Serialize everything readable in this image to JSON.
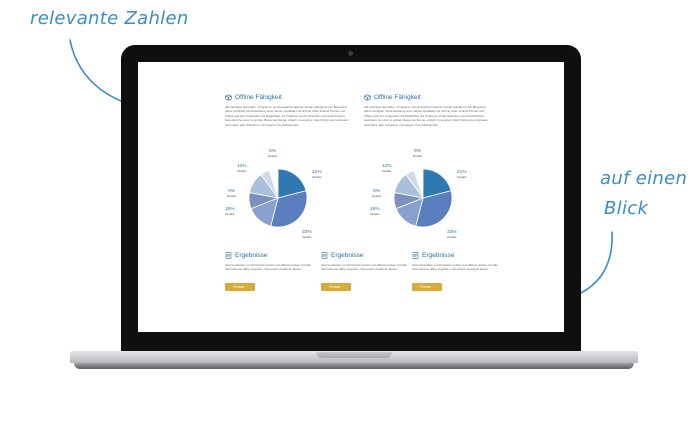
{
  "annotations": {
    "top_left": "relevante Zahlen",
    "right_line1": "auf einen",
    "right_line2": "Blick"
  },
  "sections": [
    {
      "title": "Offline Fähigkeit",
      "body": "Alle wichtigen Ausstellter-, Programm- und Zusatzinformationen wurden ständig für den Besuchern offline verfügbar. Die Entwicklung einer nativen Applikation für iPhone, iPad, Android Phones und Tablets galt dem Organisator die Möglichkeit, die Probleme mit der fehlenden Internetverbindung, besonders bei einer so großen Messe wie Ikonga, einfach zu umgehen. Das Prinzip einer optimalen Information aller Teilnehmer und steigern Ihre Zufriedenheit.",
      "pie": [
        {
          "value": "21%",
          "detail": "Details",
          "pct": 21
        },
        {
          "value": "33%",
          "detail": "Details",
          "pct": 33
        },
        {
          "value": "15%",
          "detail": "Details",
          "pct": 15
        },
        {
          "value": "9%",
          "detail": "Details",
          "pct": 9
        },
        {
          "value": "12%",
          "detail": "Details",
          "pct": 12
        },
        {
          "value": "5%",
          "detail": "Details",
          "pct": 5
        }
      ]
    },
    {
      "title": "Offline Fähigkeit",
      "body": "Alle wichtigen Ausstellter-, Programm- und Zusatzinformationen wurden ständig für den Besuchern offline verfügbar. Die Entwicklung einer nativen Applikation für iPhone, iPad, Android Phones und Tablets galt dem Organisator die Möglichkeit, die Probleme mit der fehlenden Internetverbindung, besonders bei einer so großen Messe wie Ikonga, einfach zu umgehen. Das Prinzip einer optimalen Information aller Teilnehmer und steigern Ihre Zufriedenheit.",
      "pie": [
        {
          "value": "21%",
          "detail": "Details",
          "pct": 21
        },
        {
          "value": "33%",
          "detail": "Details",
          "pct": 33
        },
        {
          "value": "15%",
          "detail": "Details",
          "pct": 15
        },
        {
          "value": "9%",
          "detail": "Details",
          "pct": 9
        },
        {
          "value": "12%",
          "detail": "Details",
          "pct": 12
        },
        {
          "value": "5%",
          "detail": "Details",
          "pct": 5
        }
      ]
    }
  ],
  "slice_colors": [
    "#2f79b3",
    "#5b7fbe",
    "#8aa0ce",
    "#7d8fbd",
    "#a9bfdc",
    "#d0dbea"
  ],
  "results": [
    {
      "title": "Ergebnisse",
      "body": "Nach Ausstellern und Produkten sortiert und effizient suchen. Auf alle Informationen offline zugreifen. Voll einfach navigieren lassen.",
      "button": "Produkt"
    },
    {
      "title": "Ergebnisse",
      "body": "Nach Ausstellern und Produkten sortiert und effizient suchen. Auf alle Informationen offline zugreifen. Voll einfach navigieren lassen.",
      "button": "Produkt"
    },
    {
      "title": "Ergebnisse",
      "body": "Nach Ausstellern und Produkten sortiert und effizient suchen. Auf alle Informationen offline zugreifen. Voll einfach navigieren lassen.",
      "button": "Produkt"
    }
  ],
  "icons": {
    "section": "cube-icon",
    "result": "document-icon",
    "button": "chevron-right-icon"
  }
}
